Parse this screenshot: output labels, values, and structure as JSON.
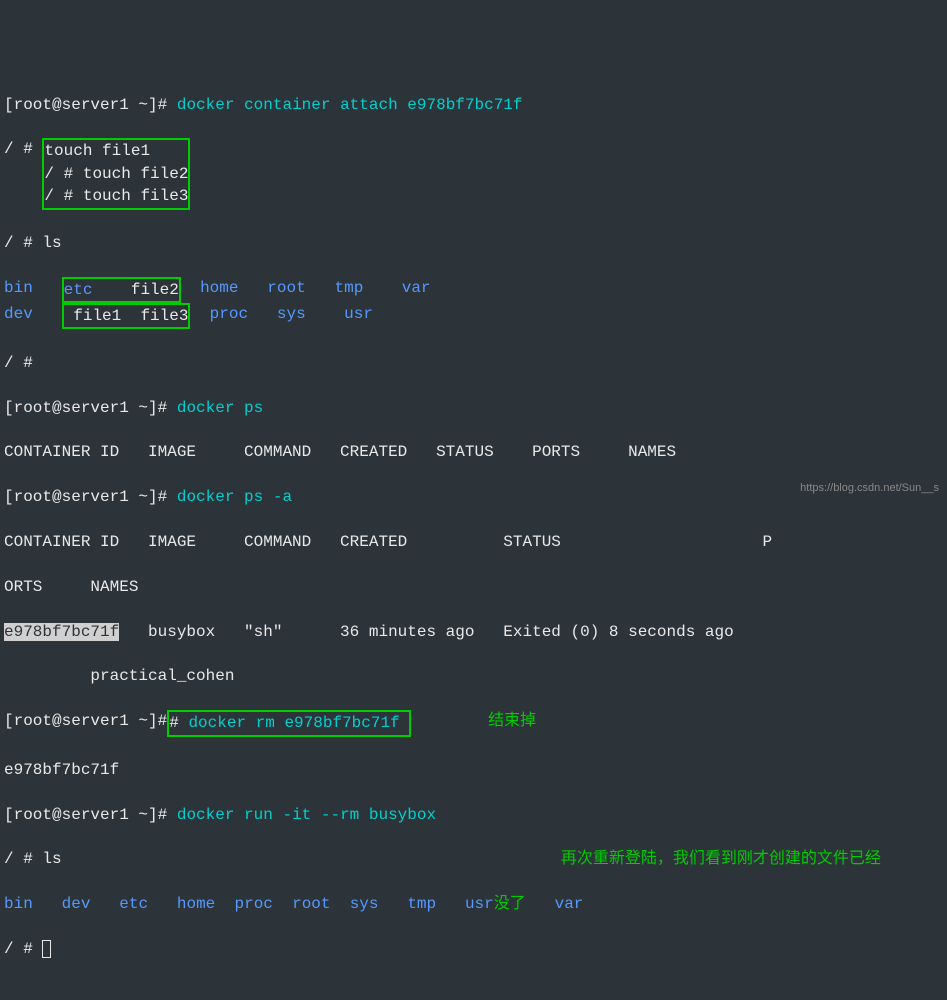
{
  "prompt_root": "[root@server1 ~]#",
  "prompt_sh": "/ #",
  "cmd_attach": "docker container attach e978bf7bc71f",
  "touch1": "touch file1",
  "touch2": "touch file2",
  "touch3": "touch file3",
  "cmd_ls": "ls",
  "ls_items": {
    "bin": "bin",
    "etc": "etc",
    "file2": "file2",
    "home": "home",
    "root": "root",
    "tmp": "tmp",
    "var": "var",
    "dev": "dev",
    "file1": "file1",
    "file3": "file3",
    "proc": "proc",
    "sys": "sys",
    "usr": "usr"
  },
  "cmd_ps": "docker ps",
  "ps_header": "CONTAINER ID   IMAGE     COMMAND   CREATED   STATUS    PORTS     NAMES",
  "cmd_psa": "docker ps -a",
  "psa_header": "CONTAINER ID   IMAGE     COMMAND   CREATED          STATUS                     P",
  "psa_header2": "ORTS     NAMES",
  "container_id": "e978bf7bc71f",
  "psa_row": "   busybox   \"sh\"      36 minutes ago   Exited (0) 8 seconds ago",
  "psa_name": "         practical_cohen",
  "cmd_rm": "docker rm e978bf7bc71f",
  "rm_output": "e978bf7bc71f",
  "annotation1": "结束掉",
  "cmd_run": "docker run -it --rm busybox",
  "annotation2": "再次重新登陆，我们看到刚才创建的文件已经",
  "annotation3": "没了",
  "watermark": "https://blog.csdn.net/Sun__s"
}
